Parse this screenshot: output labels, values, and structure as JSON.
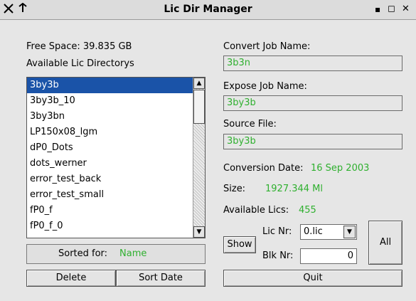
{
  "window": {
    "title": "Lic Dir Manager",
    "icon_name": "x-icon",
    "pin_icon": "pin-icon"
  },
  "controls": {
    "minimize": "▪",
    "maximize": "◻",
    "close": "✕"
  },
  "left": {
    "free_space": "Free Space: 39.835 GB",
    "available_dirs_label": "Available Lic Directorys",
    "items": [
      "3by3b",
      "3by3b_10",
      "3by3bn",
      "LP150x08_lgm",
      "dP0_Dots",
      "dots_werner",
      "error_test_back",
      "error_test_small",
      "fP0_f",
      "fP0_f_0"
    ],
    "selected_index": 0,
    "sorted_label": "Sorted for:",
    "sorted_value": "Name",
    "delete_button": "Delete",
    "sort_date_button": "Sort Date"
  },
  "right": {
    "convert_job_label": "Convert Job Name:",
    "convert_job_value": "3b3n",
    "expose_job_label": "Expose Job Name:",
    "expose_job_value": "3by3b",
    "source_file_label": "Source File:",
    "source_file_value": "3by3b",
    "conversion_date_label": "Conversion Date:",
    "conversion_date_value": "16 Sep 2003",
    "size_label": "Size:",
    "size_value": "1927.344 Ml",
    "available_lics_label": "Available Lics:",
    "available_lics_value": "455",
    "show_button": "Show",
    "lic_nr_label": "Lic Nr:",
    "lic_nr_value": "0.lic",
    "blk_nr_label": "Blk Nr:",
    "blk_nr_value": "0",
    "all_button": "All",
    "quit_button": "Quit"
  },
  "colors": {
    "value_green": "#2fb02f",
    "selection_blue": "#1a53a8"
  }
}
